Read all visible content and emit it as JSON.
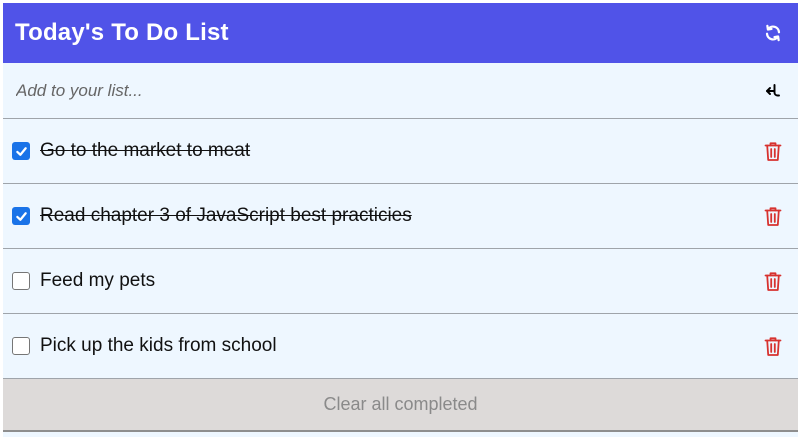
{
  "header": {
    "title": "Today's To Do List",
    "refresh_icon": "refresh-icon"
  },
  "add": {
    "placeholder": "Add to your list...",
    "value": "",
    "enter_icon": "enter-icon"
  },
  "todos": [
    {
      "text": "Go to the market to meat",
      "completed": true
    },
    {
      "text": "Read chapter 3 of JavaScript best practicies",
      "completed": true
    },
    {
      "text": "Feed my pets",
      "completed": false
    },
    {
      "text": "Pick up the kids from school",
      "completed": false
    }
  ],
  "footer": {
    "clear_label": "Clear all completed"
  },
  "colors": {
    "header_bg": "#5053e8",
    "list_bg": "#eef7ff",
    "trash": "#d7322f",
    "checkbox": "#1a73e8",
    "footer_bg": "#dddad9"
  }
}
